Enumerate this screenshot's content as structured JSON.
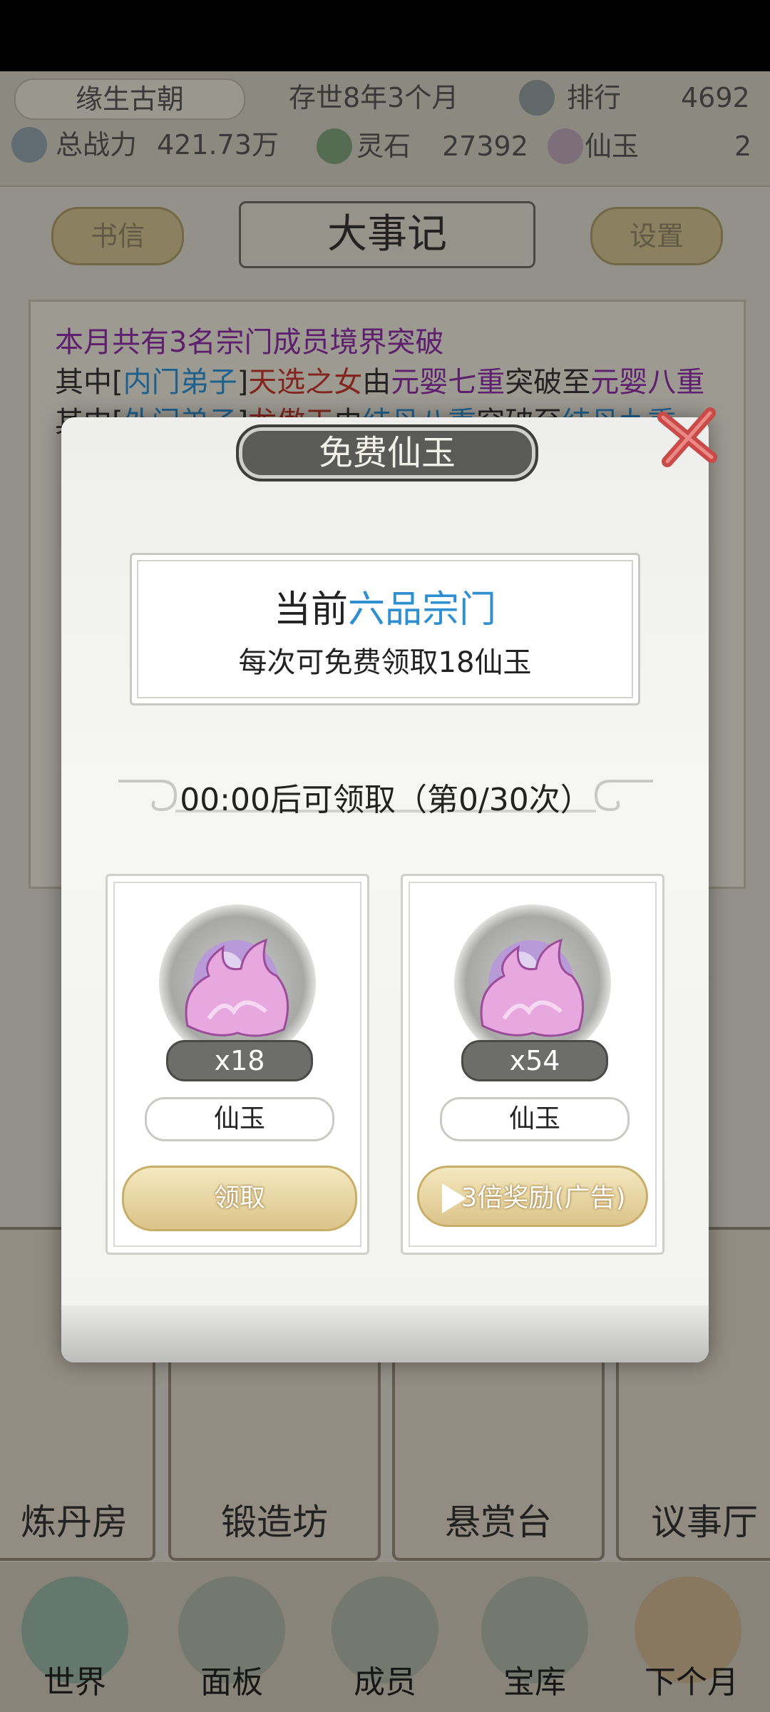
{
  "header": {
    "sect_name": "缘生古朝",
    "age": "存世8年3个月",
    "rank_label": "排行",
    "rank_value": "4692",
    "power_label": "总战力",
    "power_value": "421.73万",
    "stone_label": "灵石",
    "stone_value": "27392",
    "jade_label": "仙玉",
    "jade_value": "2"
  },
  "toolbar": {
    "letters_label": "书信",
    "title": "大事记",
    "settings_label": "设置"
  },
  "log": {
    "line1": "本月共有3名宗门成员境界突破",
    "line2": {
      "prefix": "其中[",
      "rank": "内门弟子",
      "mid": "]",
      "name": "天选之女",
      "by": "由",
      "from": "元婴七重",
      "verb": "突破至",
      "to": "元婴八重"
    },
    "line3": {
      "prefix": "其中[",
      "rank": "外门弟子",
      "mid": "]",
      "name": "龙傲天",
      "by": "由",
      "from": "结丹八重",
      "verb": "突破至",
      "to": "结丹九重"
    }
  },
  "buildings": [
    "炼丹房",
    "锻造坊",
    "悬赏台",
    "议事厅"
  ],
  "nav": [
    "世界",
    "面板",
    "成员",
    "宝库",
    "下个月"
  ],
  "dialog": {
    "title": "免费仙玉",
    "current_prefix": "当前",
    "sect_grade": "六品宗门",
    "per_claim": "每次可免费领取18仙玉",
    "timer": "00:00后可领取（第0/30次）",
    "rewards": [
      {
        "qty": "x18",
        "name": "仙玉",
        "button": "领取"
      },
      {
        "qty": "x54",
        "name": "仙玉",
        "button": "3倍奖励(广告)"
      }
    ]
  },
  "colors": {
    "accent_blue": "#2f8fd0",
    "log_purple": "#8a2fa2",
    "log_red": "#c0392b",
    "gold_button": "#dcc48a"
  }
}
